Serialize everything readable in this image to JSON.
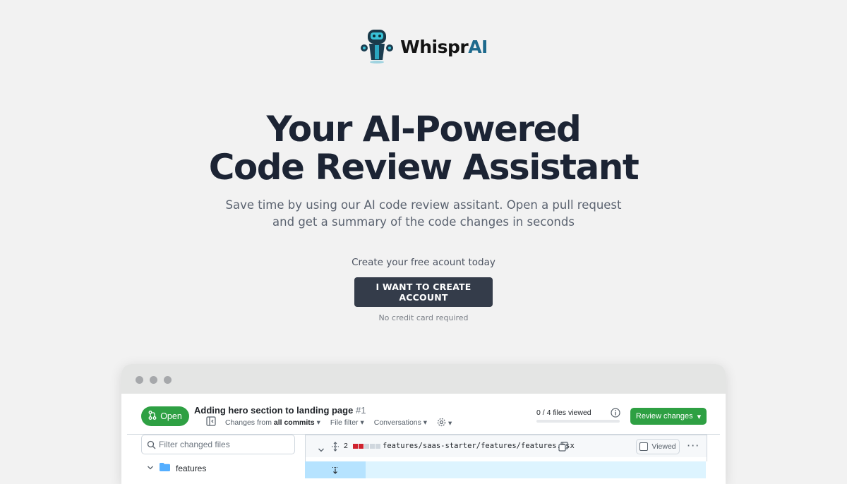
{
  "brand": {
    "name_prefix": "Whispr",
    "name_suffix": "AI",
    "logo_icon": "robot-icon"
  },
  "hero": {
    "title_line1": "Your AI-Powered",
    "title_line2": "Code Review Assistant",
    "subtitle_line1": "Save time by using our AI code review assitant. Open a pull request",
    "subtitle_line2": "and get a summary of the code changes in seconds"
  },
  "cta": {
    "lead": "Create your free acount today",
    "button_label": "I WANT TO CREATE ACCOUNT",
    "note": "No credit card required"
  },
  "preview": {
    "status_label": "Open",
    "pr_title": "Adding hero section to landing page",
    "pr_number": "#1",
    "changes_from_prefix": "Changes from",
    "changes_from_value": "all commits",
    "file_filter": "File filter",
    "conversations": "Conversations",
    "files_viewed": "0 / 4 files viewed",
    "review_button": "Review changes",
    "filter_placeholder": "Filter changed files",
    "tree_folder": "features",
    "file_change_count": "2",
    "file_path": "features/saas-starter/features/features.tsx",
    "viewed_label": "Viewed",
    "colors": {
      "green": "#2ea043",
      "deleted": "#cf222e",
      "folder": "#54aeff"
    }
  }
}
